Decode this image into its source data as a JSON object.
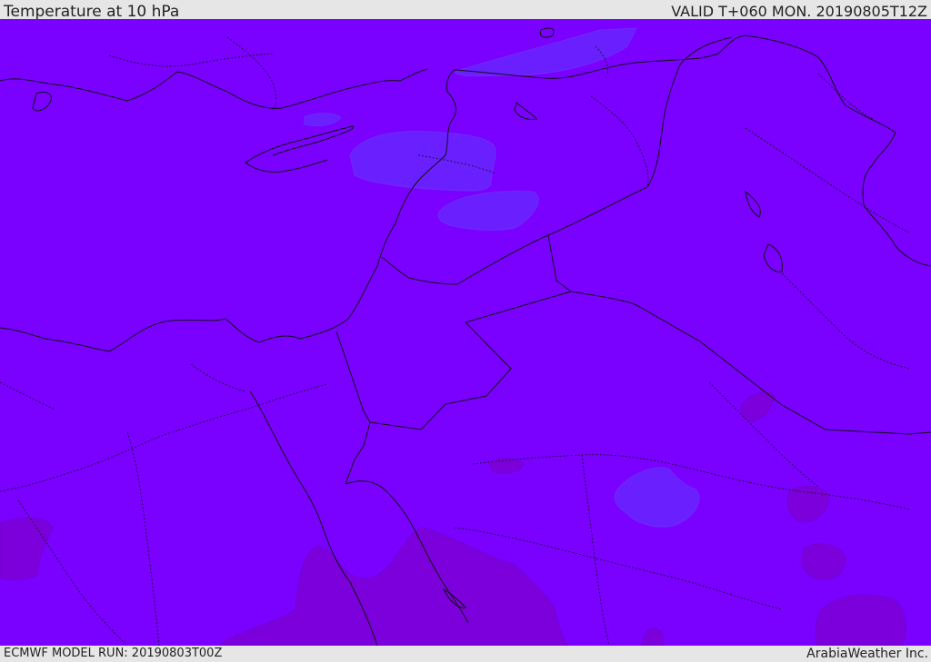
{
  "header": {
    "title": "Temperature at 10 hPa",
    "valid": "VALID T+060 MON. 20190805T12Z"
  },
  "footer": {
    "model_run": "ECMWF MODEL RUN: 20190803T00Z",
    "credit": "ArabiaWeather Inc."
  },
  "map": {
    "field_colors": {
      "base": "#7a00ff",
      "warmer": "#6a1fff",
      "cooler": "#7a00dd"
    },
    "line_color": "#111111"
  }
}
